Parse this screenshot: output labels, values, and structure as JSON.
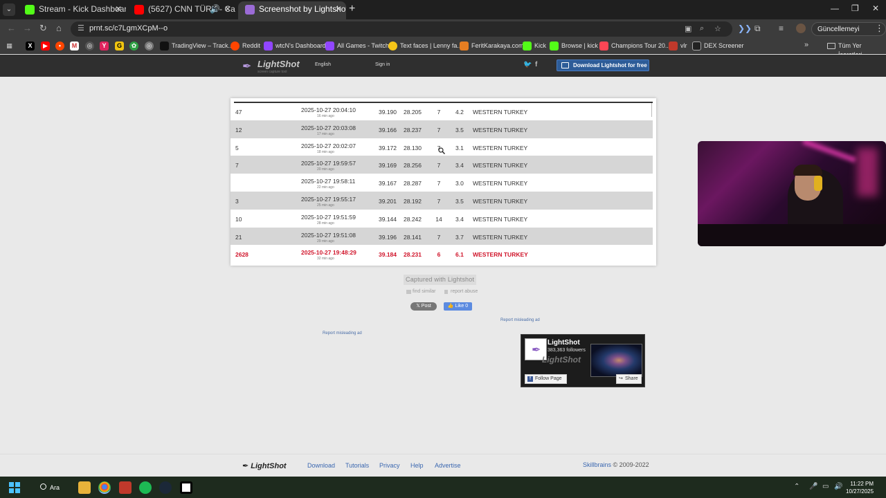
{
  "browser": {
    "tabs": [
      {
        "title": "Stream - Kick Dashboard",
        "favicon": "kick-icon",
        "color": "#53fc18"
      },
      {
        "title": "(5627) CNN TÜRK - Ca",
        "favicon": "youtube-icon",
        "color": "#ff0000"
      },
      {
        "title": "Screenshot by Lightshot",
        "favicon": "lightshot-icon",
        "color": "#9b6bd6"
      }
    ],
    "url": "prnt.sc/c7LgmXCpM--o",
    "update_label": "Güncellemeyi tamamla",
    "bookmarks": [
      {
        "label": "TradingView – Track...",
        "icon": "tradingview-icon"
      },
      {
        "label": "Reddit",
        "icon": "reddit-icon"
      },
      {
        "label": "wtcN's Dashboard",
        "icon": "twitch-icon"
      },
      {
        "label": "All Games - Twitch",
        "icon": "twitch-icon"
      },
      {
        "label": "Text faces | Lenny fa...",
        "icon": "smiley-icon"
      },
      {
        "label": "FeritKarakaya.com",
        "icon": "ferit-icon"
      },
      {
        "label": "Kick",
        "icon": "kick-icon"
      },
      {
        "label": "Browse | kick",
        "icon": "kick-icon"
      },
      {
        "label": "Champions Tour 20...",
        "icon": "vct-icon"
      },
      {
        "label": "vlr",
        "icon": "vlr-icon"
      },
      {
        "label": "DEX Screener",
        "icon": "dexscreener-icon"
      }
    ],
    "bookmarks_folder": "Tüm Yer İşaretleri"
  },
  "lightshot_header": {
    "logo": "LightShot",
    "tagline": "screen capture tool",
    "language": "English",
    "sign_in": "Sign in",
    "download_label": "Download Lightshot for free"
  },
  "screenshot_table": {
    "rows": [
      {
        "id": "47",
        "date": "2025-10-27 20:04:10",
        "ago": "16 min ago",
        "lat": "39.190",
        "lon": "28.205",
        "depth": "7",
        "mag": "4.2",
        "region": "WESTERN TURKEY",
        "shade": false,
        "alert": false
      },
      {
        "id": "12",
        "date": "2025-10-27 20:03:08",
        "ago": "17 min ago",
        "lat": "39.166",
        "lon": "28.237",
        "depth": "7",
        "mag": "3.5",
        "region": "WESTERN TURKEY",
        "shade": true,
        "alert": false
      },
      {
        "id": "5",
        "date": "2025-10-27 20:02:07",
        "ago": "18 min ago",
        "lat": "39.172",
        "lon": "28.130",
        "depth": "7",
        "mag": "3.1",
        "region": "WESTERN TURKEY",
        "shade": false,
        "alert": false
      },
      {
        "id": "7",
        "date": "2025-10-27 19:59:57",
        "ago": "20 min ago",
        "lat": "39.169",
        "lon": "28.256",
        "depth": "7",
        "mag": "3.4",
        "region": "WESTERN TURKEY",
        "shade": true,
        "alert": false
      },
      {
        "id": "",
        "date": "2025-10-27 19:58:11",
        "ago": "22 min ago",
        "lat": "39.167",
        "lon": "28.287",
        "depth": "7",
        "mag": "3.0",
        "region": "WESTERN TURKEY",
        "shade": false,
        "alert": false
      },
      {
        "id": "3",
        "date": "2025-10-27 19:55:17",
        "ago": "25 min ago",
        "lat": "39.201",
        "lon": "28.192",
        "depth": "7",
        "mag": "3.5",
        "region": "WESTERN TURKEY",
        "shade": true,
        "alert": false
      },
      {
        "id": "10",
        "date": "2025-10-27 19:51:59",
        "ago": "28 min ago",
        "lat": "39.144",
        "lon": "28.242",
        "depth": "14",
        "mag": "3.4",
        "region": "WESTERN TURKEY",
        "shade": false,
        "alert": false
      },
      {
        "id": "21",
        "date": "2025-10-27 19:51:08",
        "ago": "29 min ago",
        "lat": "39.196",
        "lon": "28.141",
        "depth": "7",
        "mag": "3.7",
        "region": "WESTERN TURKEY",
        "shade": true,
        "alert": false
      },
      {
        "id": "2628",
        "date": "2025-10-27 19:48:29",
        "ago": "32 min ago",
        "lat": "39.184",
        "lon": "28.231",
        "depth": "6",
        "mag": "6.1",
        "region": "WESTERN TURKEY",
        "shade": false,
        "alert": true
      }
    ]
  },
  "below_shot": {
    "captured": "Captured with Lightshot",
    "find_similar": "find similar",
    "report_abuse": "report abuse",
    "x_post": "Post",
    "fb_like": "Like 0",
    "report_ad_right": "Report misleading ad",
    "report_ad_left": "Report misleading ad"
  },
  "fb_widget": {
    "title": "LightShot",
    "followers": "383,363 followers",
    "watermark": "LightShot",
    "follow": "Follow Page",
    "share": "Share"
  },
  "footer": {
    "logo": "LightShot",
    "links": [
      "Download",
      "Tutorials",
      "Privacy",
      "Help",
      "Advertise"
    ],
    "company": "Skillbrains",
    "copyright": " © 2009-2022"
  },
  "taskbar": {
    "search": "Ara",
    "time": "11:22 PM",
    "date": "10/27/2025"
  }
}
